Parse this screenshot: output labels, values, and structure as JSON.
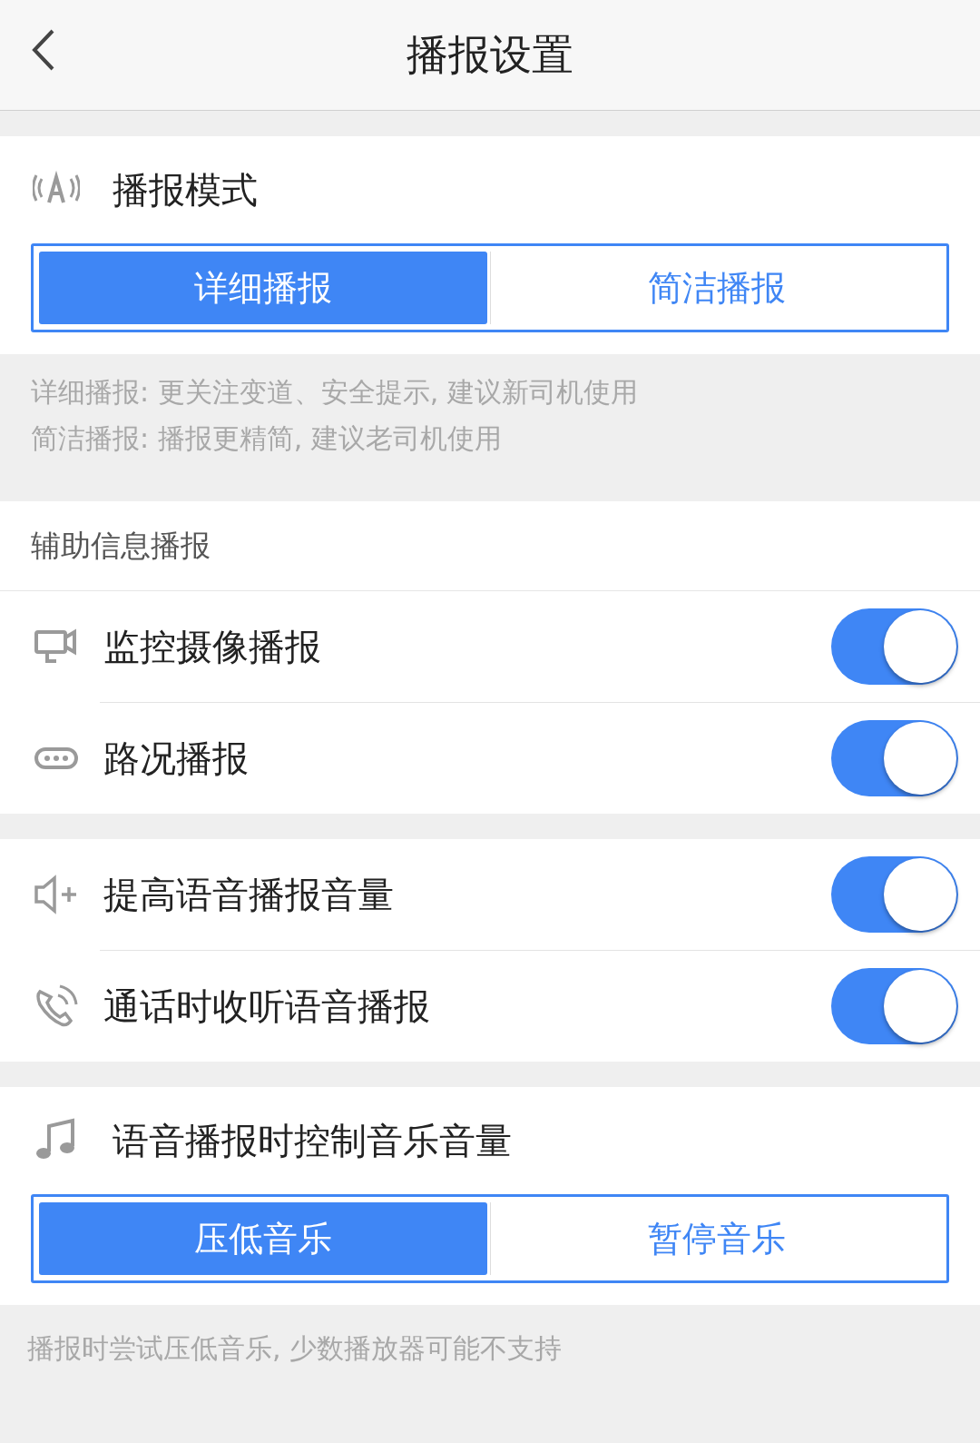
{
  "header": {
    "title": "播报设置"
  },
  "mode_section": {
    "title": "播报模式",
    "options": [
      {
        "label": "详细播报",
        "selected": true
      },
      {
        "label": "简洁播报",
        "selected": false
      }
    ]
  },
  "mode_notes": [
    "详细播报: 更关注变道、安全提示, 建议新司机使用",
    "简洁播报: 播报更精简, 建议老司机使用"
  ],
  "aux_header": "辅助信息播报",
  "toggle_groups": [
    [
      {
        "kind": "camera",
        "label": "监控摄像播报",
        "on": true
      },
      {
        "kind": "traffic",
        "label": "路况播报",
        "on": true
      }
    ],
    [
      {
        "kind": "volume",
        "label": "提高语音播报音量",
        "on": true
      },
      {
        "kind": "phone",
        "label": "通话时收听语音播报",
        "on": true
      }
    ]
  ],
  "music_section": {
    "title": "语音播报时控制音乐音量",
    "options": [
      {
        "label": "压低音乐",
        "selected": true
      },
      {
        "label": "暂停音乐",
        "selected": false
      }
    ]
  },
  "music_note": "播报时尝试压低音乐, 少数播放器可能不支持"
}
